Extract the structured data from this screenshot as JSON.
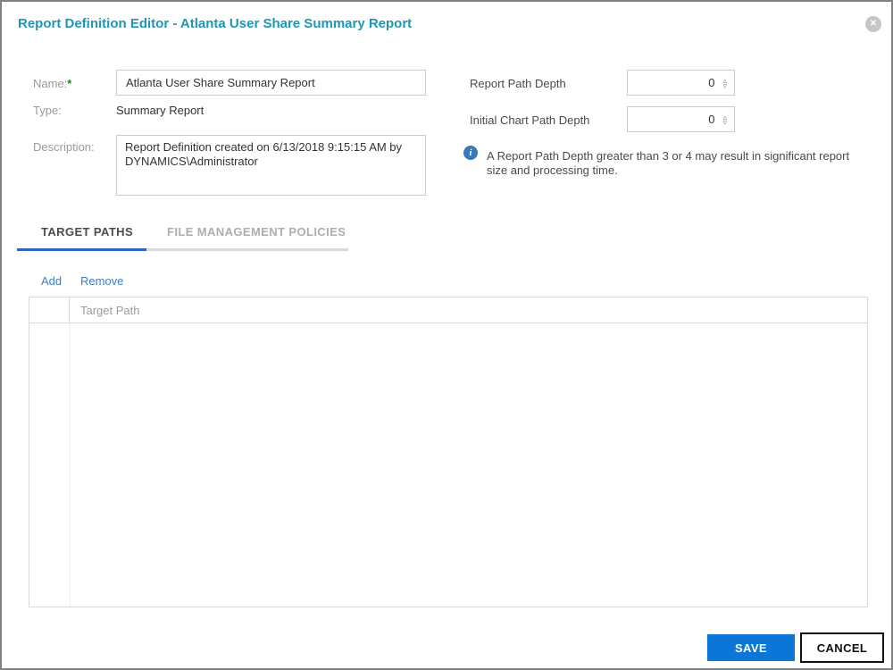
{
  "dialog": {
    "title": "Report Definition Editor - Atlanta User Share Summary Report",
    "close_icon": "x-in-circle-icon"
  },
  "form": {
    "name_label": "Name:",
    "required_marker": "*",
    "name_value": "Atlanta User Share Summary Report",
    "type_label": "Type:",
    "type_value": "Summary Report",
    "description_label": "Description:",
    "description_value": "Report Definition created on 6/13/2018 9:15:15 AM by DYNAMICS\\Administrator",
    "report_path_depth_label": "Report Path Depth",
    "report_path_depth_value": "0",
    "initial_chart_path_depth_label": "Initial Chart Path Depth",
    "initial_chart_path_depth_value": "0",
    "spinner_up_glyph": "▵",
    "spinner_down_glyph": "▿",
    "info_icon_glyph": "i",
    "info_message": "A Report Path Depth greater than 3 or 4 may result in significant report size and processing time."
  },
  "tabs": [
    {
      "label": "TARGET PATHS",
      "active": true
    },
    {
      "label": "FILE MANAGEMENT POLICIES",
      "active": false
    }
  ],
  "toolbar": {
    "add_label": "Add",
    "remove_label": "Remove"
  },
  "table": {
    "columns": [
      "",
      "Target Path"
    ],
    "rows": []
  },
  "footer": {
    "save_label": "SAVE",
    "cancel_label": "CANCEL"
  },
  "colors": {
    "title_teal": "#1f96b4",
    "accent_blue": "#0b76d8",
    "tab_underline_blue": "#2b66c4",
    "link_blue": "#3d7dc2",
    "info_icon_blue": "#3a79b8",
    "required_green": "#089408",
    "label_gray": "#9b9b9b",
    "border_gray": "#cccccc",
    "grid_border_gray": "#d9d9d9"
  }
}
